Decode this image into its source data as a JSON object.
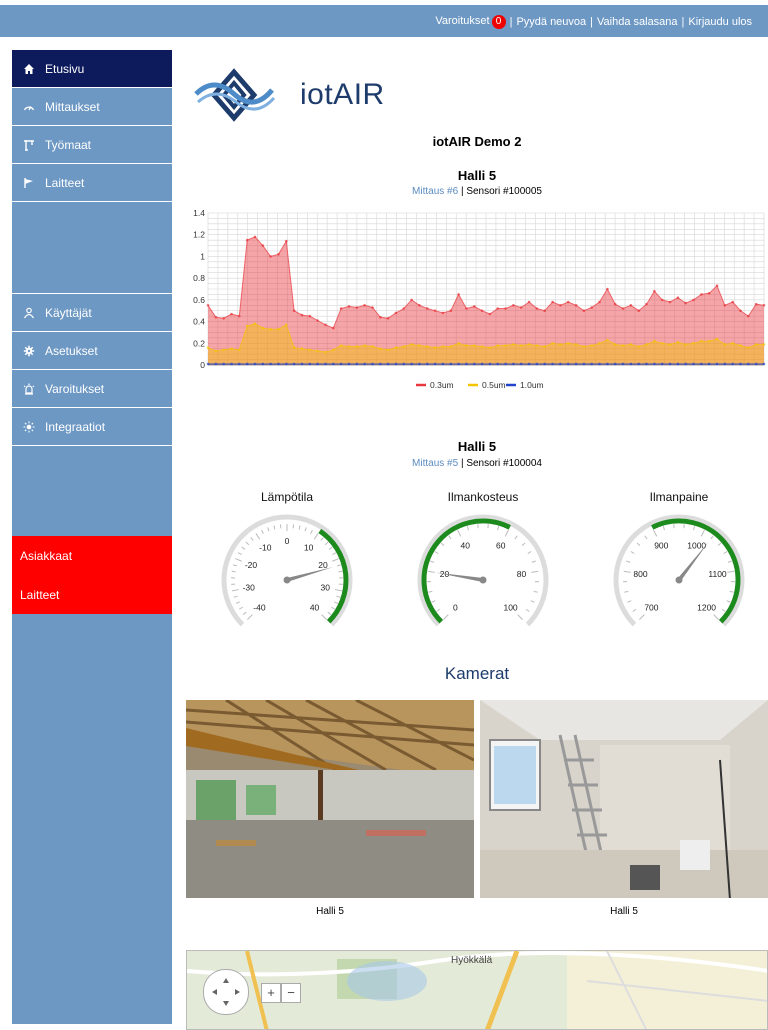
{
  "topbar": {
    "warnings_label": "Varoitukset",
    "warnings_count": "0",
    "links": [
      "Pyydä neuvoa",
      "Vaihda salasana",
      "Kirjaudu ulos"
    ]
  },
  "sidebar": {
    "items": [
      {
        "label": "Etusivu",
        "icon": "home-icon"
      },
      {
        "label": "Mittaukset",
        "icon": "gauge-icon"
      },
      {
        "label": "Työmaat",
        "icon": "crane-icon"
      },
      {
        "label": "Laitteet",
        "icon": "flag-icon"
      }
    ],
    "items2": [
      {
        "label": "Käyttäjät",
        "icon": "users-icon"
      },
      {
        "label": "Asetukset",
        "icon": "gear-icon"
      },
      {
        "label": "Varoitukset",
        "icon": "alarm-icon"
      },
      {
        "label": "Integraatiot",
        "icon": "sun-icon"
      }
    ],
    "red_items": [
      "Asiakkaat",
      "Laitteet"
    ]
  },
  "logo": {
    "text": "iotAIR"
  },
  "page_title": "iotAIR Demo 2",
  "chart_section": {
    "title": "Halli 5",
    "measurement_link": "Mittaus #6",
    "sensor": "Sensori #100005"
  },
  "gauge_section": {
    "title": "Halli 5",
    "measurement_link": "Mittaus #5",
    "sensor": "Sensori #100004"
  },
  "cameras_title": "Kamerat",
  "cameras": [
    {
      "caption": "Halli 5"
    },
    {
      "caption": "Halli 5"
    }
  ],
  "map": {
    "place": "Hyökkälä",
    "zoom_in": "+",
    "zoom_out": "−"
  },
  "colors": {
    "nav_bg": "#6d98c4",
    "nav_active": "#0d1a5c",
    "alert_red": "#ff0000",
    "series1": "#e8383d",
    "series2": "#f5c400",
    "series3": "#2244cc"
  },
  "chart_data": {
    "type": "area",
    "title": "",
    "xlabel": "",
    "ylabel": "",
    "ylim": [
      0,
      1.4
    ],
    "yticks": [
      0,
      0.2,
      0.4,
      0.6,
      0.8,
      1,
      1.2,
      1.4
    ],
    "ytick_labels": [
      "0",
      "0.2",
      "0.4",
      "0.6",
      "0.8",
      "1",
      "1.2",
      "1.4"
    ],
    "legend_position": "bottom",
    "series": [
      {
        "name": "0.3um",
        "color": "#e8383d",
        "values": [
          0.55,
          0.44,
          0.43,
          0.47,
          0.45,
          1.15,
          1.18,
          1.1,
          1.0,
          1.02,
          1.14,
          0.5,
          0.46,
          0.45,
          0.41,
          0.37,
          0.34,
          0.52,
          0.54,
          0.53,
          0.55,
          0.53,
          0.44,
          0.43,
          0.48,
          0.52,
          0.6,
          0.55,
          0.52,
          0.5,
          0.48,
          0.5,
          0.65,
          0.52,
          0.54,
          0.5,
          0.47,
          0.52,
          0.52,
          0.55,
          0.53,
          0.58,
          0.52,
          0.5,
          0.58,
          0.55,
          0.58,
          0.55,
          0.5,
          0.53,
          0.58,
          0.7,
          0.56,
          0.52,
          0.55,
          0.5,
          0.56,
          0.68,
          0.6,
          0.58,
          0.62,
          0.57,
          0.6,
          0.65,
          0.66,
          0.73,
          0.55,
          0.58,
          0.5,
          0.45,
          0.56,
          0.55
        ]
      },
      {
        "name": "0.5um",
        "color": "#f5c400",
        "values": [
          0.16,
          0.13,
          0.14,
          0.15,
          0.14,
          0.36,
          0.38,
          0.34,
          0.33,
          0.33,
          0.37,
          0.16,
          0.15,
          0.14,
          0.13,
          0.12,
          0.14,
          0.18,
          0.17,
          0.17,
          0.18,
          0.17,
          0.15,
          0.14,
          0.16,
          0.17,
          0.19,
          0.18,
          0.17,
          0.16,
          0.17,
          0.17,
          0.2,
          0.18,
          0.18,
          0.17,
          0.16,
          0.18,
          0.18,
          0.19,
          0.18,
          0.19,
          0.18,
          0.17,
          0.2,
          0.19,
          0.2,
          0.19,
          0.17,
          0.18,
          0.2,
          0.23,
          0.19,
          0.18,
          0.19,
          0.17,
          0.19,
          0.22,
          0.2,
          0.19,
          0.21,
          0.19,
          0.2,
          0.22,
          0.22,
          0.24,
          0.19,
          0.2,
          0.18,
          0.16,
          0.19,
          0.19
        ]
      },
      {
        "name": "1.0um",
        "color": "#2244cc",
        "values": [
          0.01,
          0.01,
          0.01,
          0.01,
          0.01,
          0.01,
          0.01,
          0.01,
          0.01,
          0.01,
          0.01,
          0.01,
          0.01,
          0.01,
          0.01,
          0.01,
          0.01,
          0.01,
          0.01,
          0.01,
          0.01,
          0.01,
          0.01,
          0.01,
          0.01,
          0.01,
          0.01,
          0.01,
          0.01,
          0.01,
          0.01,
          0.01,
          0.01,
          0.01,
          0.01,
          0.01,
          0.01,
          0.01,
          0.01,
          0.01,
          0.01,
          0.01,
          0.01,
          0.01,
          0.01,
          0.01,
          0.01,
          0.01,
          0.01,
          0.01,
          0.01,
          0.01,
          0.01,
          0.01,
          0.01,
          0.01,
          0.01,
          0.01,
          0.01,
          0.01,
          0.01,
          0.01,
          0.01,
          0.01,
          0.01,
          0.01,
          0.01,
          0.01,
          0.01,
          0.01,
          0.01,
          0.01
        ]
      }
    ]
  },
  "gauges": [
    {
      "title": "Lämpötila",
      "min": -40,
      "max": 40,
      "value": 22,
      "ticks": [
        "-40",
        "-30",
        "-20",
        "-10",
        "0",
        "10",
        "20",
        "30",
        "40"
      ],
      "green_from": 10,
      "green_to": 40
    },
    {
      "title": "Ilmankosteus",
      "min": 0,
      "max": 100,
      "value": 20,
      "ticks": [
        "0",
        "20",
        "40",
        "60",
        "80",
        "100"
      ],
      "green_from": 0,
      "green_to": 60
    },
    {
      "title": "Ilmanpaine",
      "min": 700,
      "max": 1200,
      "value": 1020,
      "ticks": [
        "700",
        "800",
        "900",
        "1000",
        "1100",
        "1200"
      ],
      "green_from": 900,
      "green_to": 1200
    }
  ]
}
